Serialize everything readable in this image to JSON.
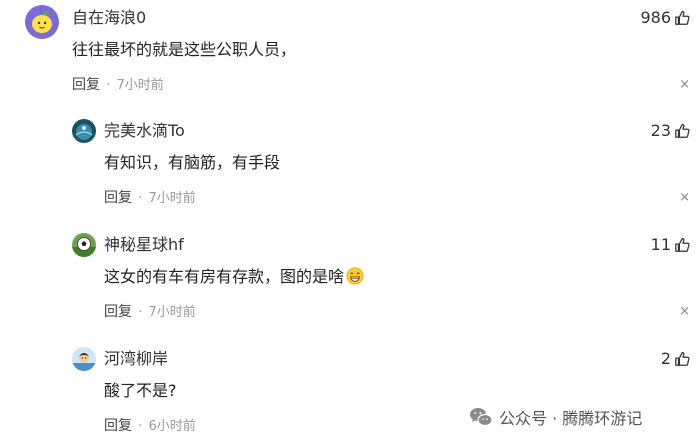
{
  "comments": [
    {
      "username": "自在海浪0",
      "text": "往往最坏的就是这些公职人员，",
      "likes": "986",
      "reply_label": "回复",
      "separator": "·",
      "time": "7小时前",
      "close": "×",
      "avatar_icon": "lemon-avatar-icon"
    },
    {
      "username": "完美水滴To",
      "text": "有知识，有脑筋，有手段",
      "likes": "23",
      "reply_label": "回复",
      "separator": "·",
      "time": "7小时前",
      "close": "×",
      "avatar_icon": "water-drop-avatar-icon"
    },
    {
      "username": "神秘星球hf",
      "text": "这女的有车有房有存款，图的是啥",
      "emoji": "grinning-face-emoji",
      "likes": "11",
      "reply_label": "回复",
      "separator": "·",
      "time": "7小时前",
      "close": "×",
      "avatar_icon": "soccer-avatar-icon"
    },
    {
      "username": "河湾柳岸",
      "text": "酸了不是?",
      "likes": "2",
      "reply_label": "回复",
      "separator": "·",
      "time": "6小时前",
      "close": "×",
      "avatar_icon": "child-avatar-icon"
    }
  ],
  "watermark": {
    "text": "公众号 · 腾腾环游记",
    "icon": "wechat-icon"
  },
  "colors": {
    "primary_text": "#222222",
    "secondary_text": "#999999",
    "lemon_avatar_bg": "#7b6bd6"
  }
}
